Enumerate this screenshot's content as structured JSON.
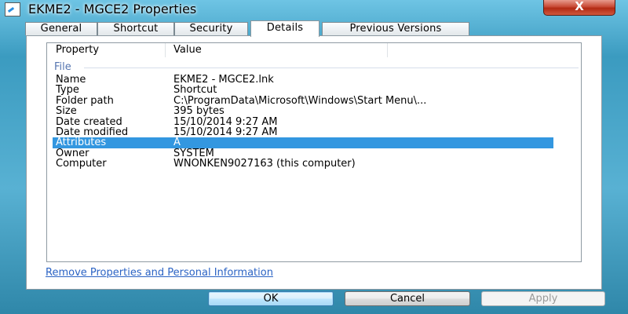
{
  "window": {
    "title": "EKME2 - MGCE2 Properties",
    "close_glyph": "X"
  },
  "tabs": [
    {
      "label": "General"
    },
    {
      "label": "Shortcut"
    },
    {
      "label": "Security"
    },
    {
      "label": "Details",
      "active": true
    },
    {
      "label": "Previous Versions"
    }
  ],
  "details": {
    "columns": {
      "property": "Property",
      "value": "Value"
    },
    "group": "File",
    "rows": [
      {
        "property": "Name",
        "value": "EKME2 - MGCE2.lnk"
      },
      {
        "property": "Type",
        "value": "Shortcut"
      },
      {
        "property": "Folder path",
        "value": "C:\\ProgramData\\Microsoft\\Windows\\Start Menu\\..."
      },
      {
        "property": "Size",
        "value": "395 bytes"
      },
      {
        "property": "Date created",
        "value": "15/10/2014 9:27 AM"
      },
      {
        "property": "Date modified",
        "value": "15/10/2014 9:27 AM"
      },
      {
        "property": "Attributes",
        "value": "A",
        "selected": true
      },
      {
        "property": "Owner",
        "value": "SYSTEM"
      },
      {
        "property": "Computer",
        "value": "WNONKEN9027163 (this computer)"
      }
    ]
  },
  "link": {
    "remove_properties": "Remove Properties and Personal Information"
  },
  "buttons": {
    "ok": "OK",
    "cancel": "Cancel",
    "apply": "Apply"
  },
  "colors": {
    "selection": "#3397e0",
    "link": "#2b63c4",
    "group_label": "#5575b0"
  }
}
